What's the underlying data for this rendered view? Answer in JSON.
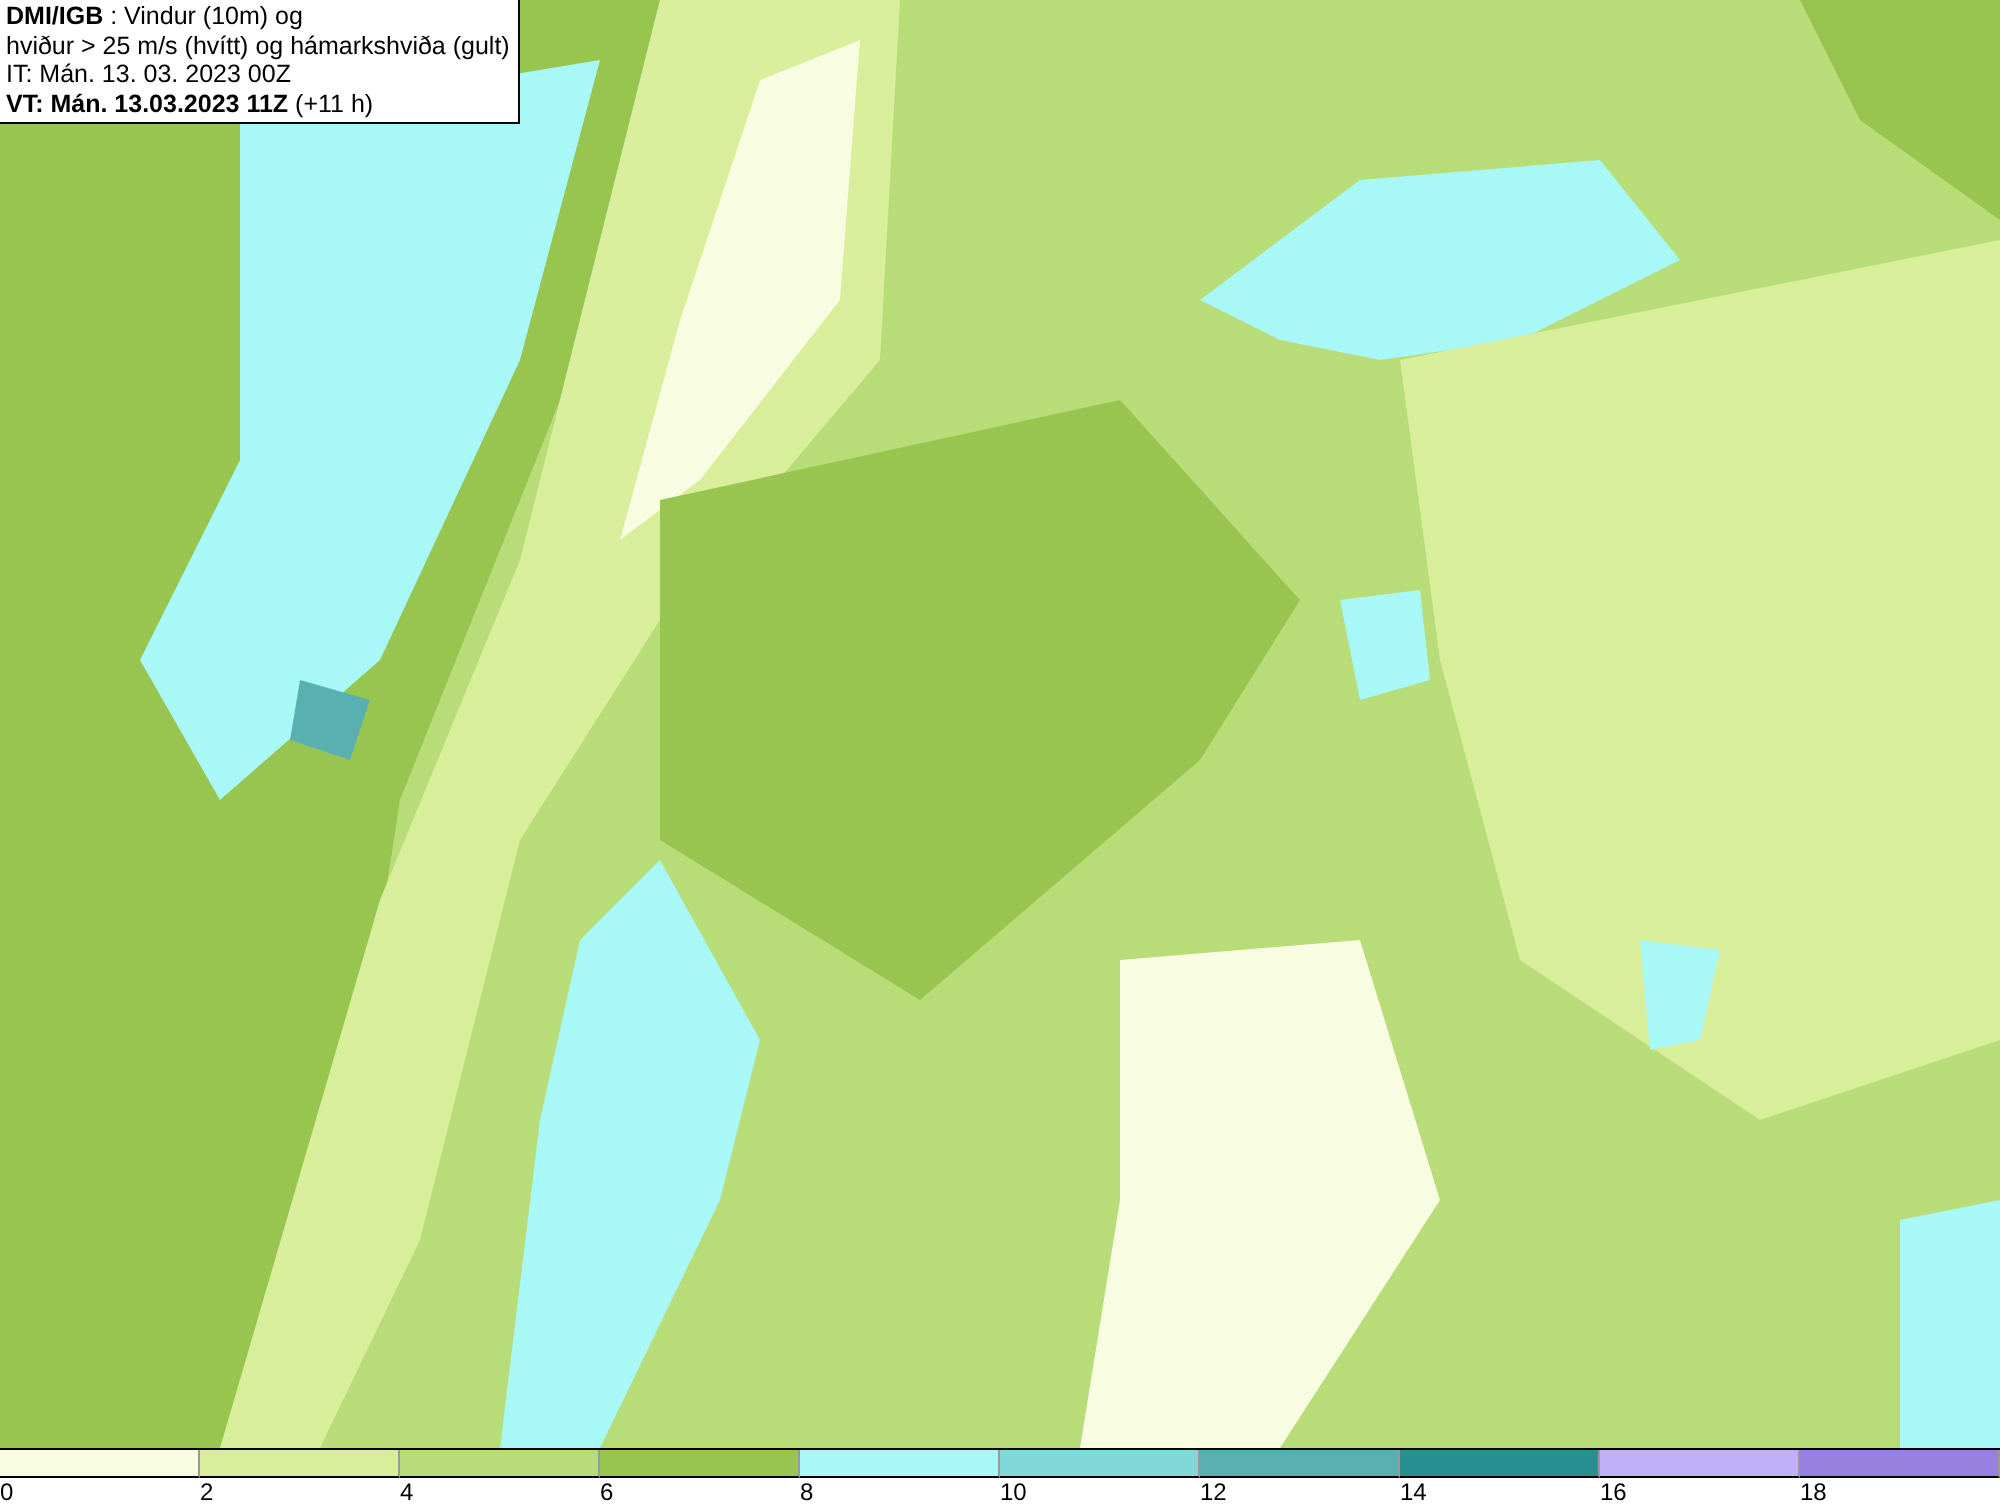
{
  "title_box": {
    "lines": [
      "**DMI/IGB** : Vindur (10m) og",
      "hviður > 25 m/s (hvítt) og hámarkshviða (gult)",
      "IT: Mán. 13. 03. 2023 00Z",
      "**VT: Mán. 13.03.2023 11Z** (+11 h)"
    ]
  },
  "legend": {
    "bins": [
      {
        "label": "0",
        "color": "#f8fce0"
      },
      {
        "label": "2",
        "color": "#d8ee9a"
      },
      {
        "label": "4",
        "color": "#b8dc78"
      },
      {
        "label": "6",
        "color": "#98c450"
      },
      {
        "label": "8",
        "color": "#a8f8f8"
      },
      {
        "label": "10",
        "color": "#80d8d8"
      },
      {
        "label": "12",
        "color": "#58b0b0"
      },
      {
        "label": "14",
        "color": "#289090"
      },
      {
        "label": "16",
        "color": "#c0b0f8"
      },
      {
        "label": "18",
        "color": "#9880e0"
      }
    ]
  }
}
